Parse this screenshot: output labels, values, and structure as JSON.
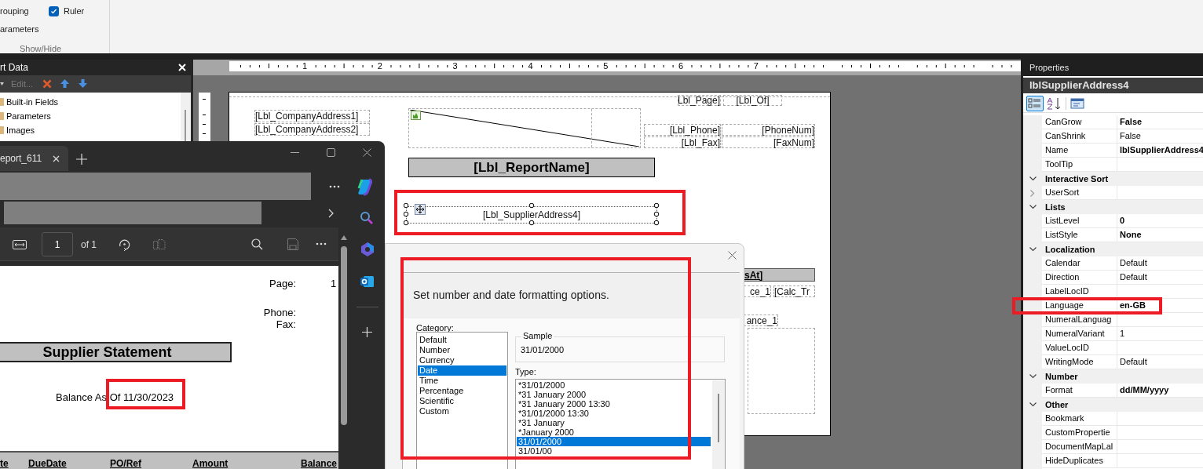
{
  "ribbon": {
    "options": [
      {
        "kind": "label",
        "label": "rouping"
      },
      {
        "kind": "checkbox",
        "label": "Ruler",
        "checked": true
      },
      {
        "kind": "label",
        "label": "arameters"
      }
    ],
    "group_label": "Show/Hide"
  },
  "report_data": {
    "title": "rt Data",
    "edit_button": {
      "label": "Edit...",
      "disabled": true
    },
    "items": [
      "Built-in Fields",
      "Parameters",
      "Images"
    ]
  },
  "designer": {
    "ruler_numbers": [
      "1",
      "2",
      "3",
      "4",
      "5",
      "6",
      "7"
    ],
    "fields": [
      {
        "kind": "label",
        "text": "Lbl_Page]"
      },
      {
        "kind": "label",
        "text": "[Lbl_Of]"
      },
      {
        "kind": "label",
        "text": "[Lbl_CompanyAddress1]"
      },
      {
        "kind": "label",
        "text": "[Lbl_CompanyAddress2]"
      },
      {
        "kind": "label",
        "text": "[Lbl_Phone]"
      },
      {
        "kind": "label",
        "text": "[PhoneNum]"
      },
      {
        "kind": "label",
        "text": "[Lbl_Fax]"
      },
      {
        "kind": "label",
        "text": "[FaxNum]"
      },
      {
        "kind": "title",
        "text": "[Lbl_ReportName]"
      },
      {
        "kind": "selected",
        "text": "[Lbl_SupplierAddress4]"
      },
      {
        "kind": "header",
        "text": "sAt]"
      },
      {
        "kind": "label",
        "text": "ce_1"
      },
      {
        "kind": "label",
        "text": "[Calc_Tr"
      },
      {
        "kind": "label",
        "text": "ance_1"
      }
    ]
  },
  "pdf_viewer": {
    "tab_title": "eport_611",
    "page_number": "1",
    "page_count": "of 1",
    "document": {
      "page_label": "Page:",
      "page_value": "1",
      "phone_label": "Phone:",
      "fax_label": "Fax:",
      "title": "Supplier Statement",
      "balance": "Balance As Of 11/30/2023",
      "columns": [
        "te",
        "DueDate",
        "PO/Ref",
        "Amount",
        "Balance"
      ]
    }
  },
  "format_dialog": {
    "heading": "Set number and date formatting options.",
    "category_label": "Category:",
    "categories": [
      {
        "label": "Default",
        "selected": false
      },
      {
        "label": "Number",
        "selected": false
      },
      {
        "label": "Currency",
        "selected": false
      },
      {
        "label": "Date",
        "selected": true
      },
      {
        "label": "Time",
        "selected": false
      },
      {
        "label": "Percentage",
        "selected": false
      },
      {
        "label": "Scientific",
        "selected": false
      },
      {
        "label": "Custom",
        "selected": false
      }
    ],
    "sample_label": "Sample",
    "sample_value": "31/01/2000",
    "type_label": "Type:",
    "types": [
      {
        "label": "*31/01/2000",
        "selected": false
      },
      {
        "label": "*31 January 2000",
        "selected": false
      },
      {
        "label": "*31 January 2000 13:30",
        "selected": false
      },
      {
        "label": "*31/01/2000 13:30",
        "selected": false
      },
      {
        "label": "*31 January",
        "selected": false
      },
      {
        "label": "*January 2000",
        "selected": false
      },
      {
        "label": "31/01/2000",
        "selected": true
      },
      {
        "label": "31/01/00",
        "selected": false
      }
    ]
  },
  "properties": {
    "title": "Properties",
    "object_name": "lblSupplierAddress4",
    "views": [
      {
        "kind": "categorized",
        "selected": true
      },
      {
        "kind": "alphabetical",
        "selected": false
      },
      {
        "kind": "pages",
        "selected": false
      }
    ],
    "rows": [
      {
        "kind": "property",
        "name": "CanGrow",
        "value": "False",
        "bold": true
      },
      {
        "kind": "property",
        "name": "CanShrink",
        "value": "False",
        "bold": false
      },
      {
        "kind": "property",
        "name": "Name",
        "value": "lblSupplierAddress4",
        "bold": true
      },
      {
        "kind": "property",
        "name": "ToolTip"
      },
      {
        "kind": "category",
        "name": "Interactive Sort",
        "expanded": true
      },
      {
        "kind": "property",
        "name": "UserSort",
        "expanded": false
      },
      {
        "kind": "category",
        "name": "Lists",
        "expanded": true
      },
      {
        "kind": "property",
        "name": "ListLevel",
        "value": "0",
        "bold": true
      },
      {
        "kind": "property",
        "name": "ListStyle",
        "value": "None",
        "bold": true
      },
      {
        "kind": "category",
        "name": "Localization",
        "expanded": true
      },
      {
        "kind": "property",
        "name": "Calendar",
        "value": "Default",
        "bold": false
      },
      {
        "kind": "property",
        "name": "Direction",
        "value": "Default",
        "bold": false
      },
      {
        "kind": "property",
        "name": "LabelLocID"
      },
      {
        "kind": "property",
        "name": "Language",
        "value": "en-GB",
        "bold": true
      },
      {
        "kind": "property",
        "name": "NumeralLanguag"
      },
      {
        "kind": "property",
        "name": "NumeralVariant",
        "value": "1",
        "bold": false
      },
      {
        "kind": "property",
        "name": "ValueLocID"
      },
      {
        "kind": "property",
        "name": "WritingMode",
        "value": "Default",
        "bold": false
      },
      {
        "kind": "category",
        "name": "Number",
        "expanded": true
      },
      {
        "kind": "property",
        "name": "Format",
        "value": "dd/MM/yyyy",
        "bold": true
      },
      {
        "kind": "category",
        "name": "Other",
        "expanded": true
      },
      {
        "kind": "property",
        "name": "Bookmark"
      },
      {
        "kind": "property",
        "name": "CustomPropertie"
      },
      {
        "kind": "property",
        "name": "DocumentMapLal"
      },
      {
        "kind": "property",
        "name": "HideDuplicates"
      }
    ]
  }
}
